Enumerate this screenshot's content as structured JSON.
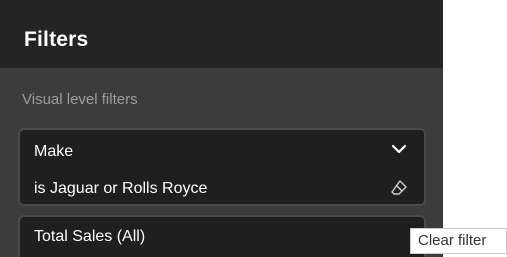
{
  "pane": {
    "title": "Filters",
    "section_label": "Visual level filters"
  },
  "filters": [
    {
      "name": "Make",
      "description": "is Jaguar or Rolls Royce",
      "expand_icon": "chevron-down-icon",
      "clear_icon": "eraser-icon"
    },
    {
      "name": "Total Sales (All)"
    }
  ],
  "tooltip": {
    "text": "Clear filter"
  },
  "colors": {
    "header_bg": "#242424",
    "pane_bg": "#3c3c3c",
    "card_bg": "#1f1f1f",
    "card_border": "#4a4a4a",
    "text_primary": "#ffffff",
    "text_muted": "#9d9d9d"
  }
}
